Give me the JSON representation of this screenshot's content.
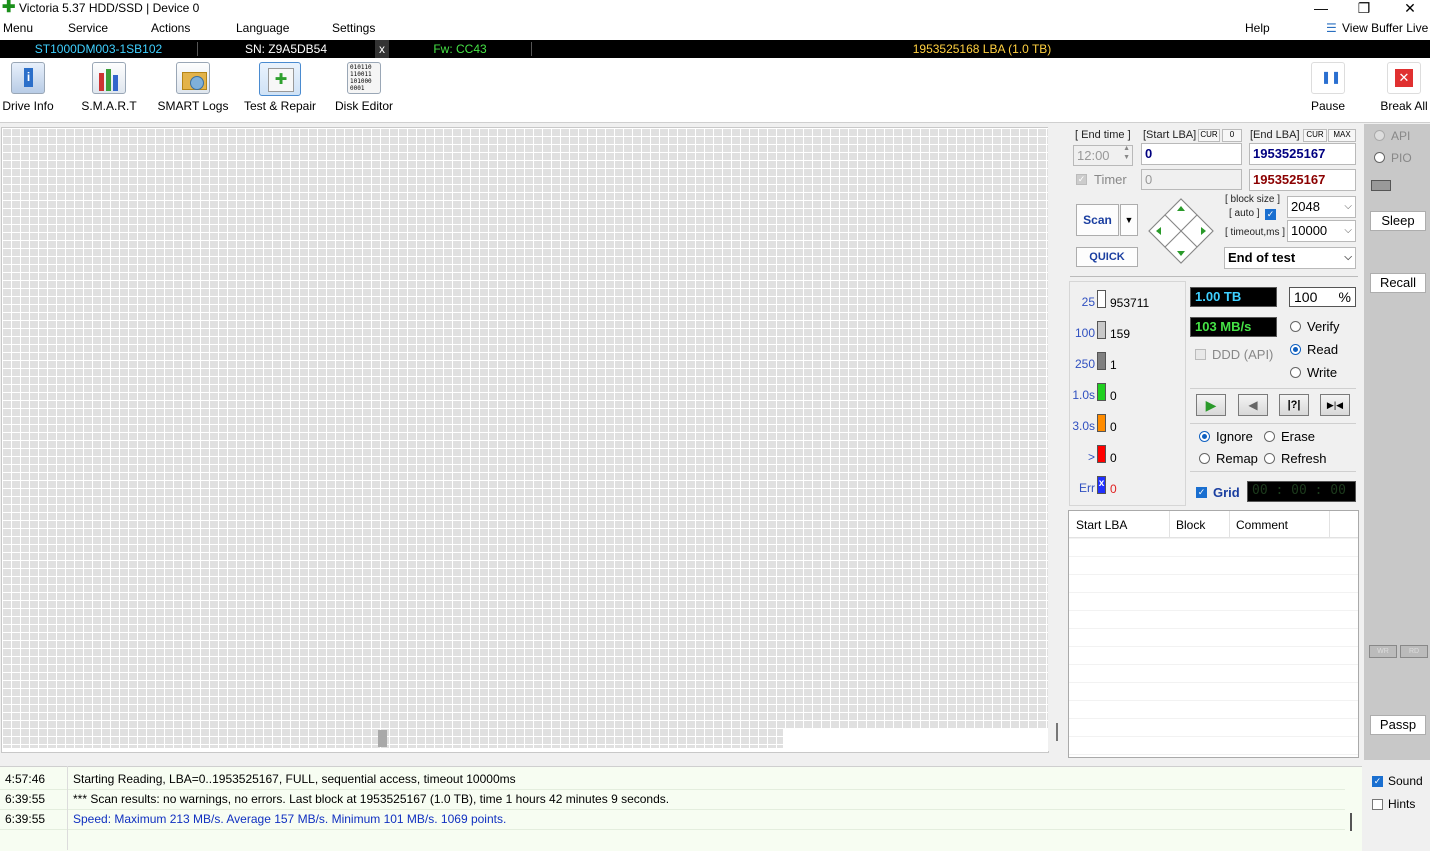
{
  "window": {
    "title": "Victoria 5.37 HDD/SSD | Device 0",
    "logo_glyph": "✚",
    "min": "—",
    "max": "❐",
    "close": "✕"
  },
  "menu": {
    "items": [
      "Menu",
      "Service",
      "Actions",
      "Language",
      "Settings"
    ],
    "help": "Help",
    "buffer_icon": "☰",
    "view_buffer": "View Buffer Live"
  },
  "drive": {
    "model": "ST1000DM003-1SB102",
    "serial": "SN: Z9A5DB54",
    "close": "x",
    "firmware": "Fw: CC43",
    "capacity": "1953525168 LBA (1.0 TB)",
    "colors": {
      "model": "#3fd0ff",
      "firmware": "#45e245",
      "capacity": "#ffd040"
    }
  },
  "toolbar": {
    "drive_info": "Drive Info",
    "smart": "S.M.A.R.T",
    "smart_logs": "SMART Logs",
    "test_repair": "Test & Repair",
    "disk_editor": "Disk Editor",
    "pause": "Pause",
    "break_all": "Break All",
    "disk_editor_icon_text": "010110\n110011\n101000\n0001",
    "info_icon": "i",
    "plus_icon": "✚",
    "pause_icon": "❚❚",
    "break_icon": "✕"
  },
  "settings": {
    "end_time_label": "[ End time ]",
    "start_lba_label": "[Start LBA]",
    "cur": "CUR",
    "start_cur_value": "0",
    "end_lba_label": "[End LBA]",
    "cur2": "CUR",
    "max": "MAX",
    "end_time_value": "12:00",
    "start_lba_value": "0",
    "end_lba_value": "1953525167",
    "timer_label": "Timer",
    "timer_value": "0",
    "end_lba_value2": "1953525167",
    "scan": "Scan",
    "quick": "QUICK",
    "block_size_label": "[ block size ]",
    "auto_label": "[ auto ]",
    "block_size": "2048",
    "timeout_label": "[ timeout,ms ]",
    "timeout": "10000",
    "end_action": "End of test"
  },
  "stats": {
    "rows": [
      {
        "label": "25",
        "value": "953711",
        "color": "#ffffff"
      },
      {
        "label": "100",
        "value": "159",
        "color": "#c8c8c8"
      },
      {
        "label": "250",
        "value": "1",
        "color": "#808080"
      },
      {
        "label": "1.0s",
        "value": "0",
        "color": "#20d020"
      },
      {
        "label": "3.0s",
        "value": "0",
        "color": "#ff8c00"
      },
      {
        "label": ">",
        "value": "0",
        "color": "#ff0000"
      },
      {
        "label": "Err",
        "value": "0",
        "color": "#2030ff"
      }
    ],
    "err_mark": "x",
    "size": "1.00 TB",
    "percent": "100",
    "percent_sign": "%",
    "speed": "103 MB/s",
    "ddd": "DDD (API)",
    "verify": "Verify",
    "read": "Read",
    "write": "Write",
    "ignore": "Ignore",
    "erase": "Erase",
    "remap": "Remap",
    "refresh": "Refresh",
    "grid": "Grid",
    "timer_display": "00 : 00 : 00",
    "play_icon": "▶",
    "back_icon": "◀",
    "skip_icon": "|?|",
    "end_icon": "▶|◀"
  },
  "table": {
    "headers": [
      "Start LBA",
      "Block",
      "Comment"
    ]
  },
  "side": {
    "api": "API",
    "pio": "PIO",
    "sleep": "Sleep",
    "recall": "Recall",
    "passp": "Passp",
    "wr": "WR",
    "rd": "RD",
    "sound": "Sound",
    "hints": "Hints"
  },
  "log": [
    {
      "time": "4:57:46",
      "msg": "Starting Reading, LBA=0..1953525167, FULL, sequential access, timeout 10000ms",
      "color": "#000000"
    },
    {
      "time": "6:39:55",
      "msg": "*** Scan results: no warnings, no errors. Last block at 1953525167 (1.0 TB), time 1 hours 42 minutes 9 seconds.",
      "color": "#000000"
    },
    {
      "time": "6:39:55",
      "msg": "Speed: Maximum 213 MB/s. Average 157 MB/s. Minimum 101 MB/s. 1069 points.",
      "color": "#1030c0"
    }
  ]
}
